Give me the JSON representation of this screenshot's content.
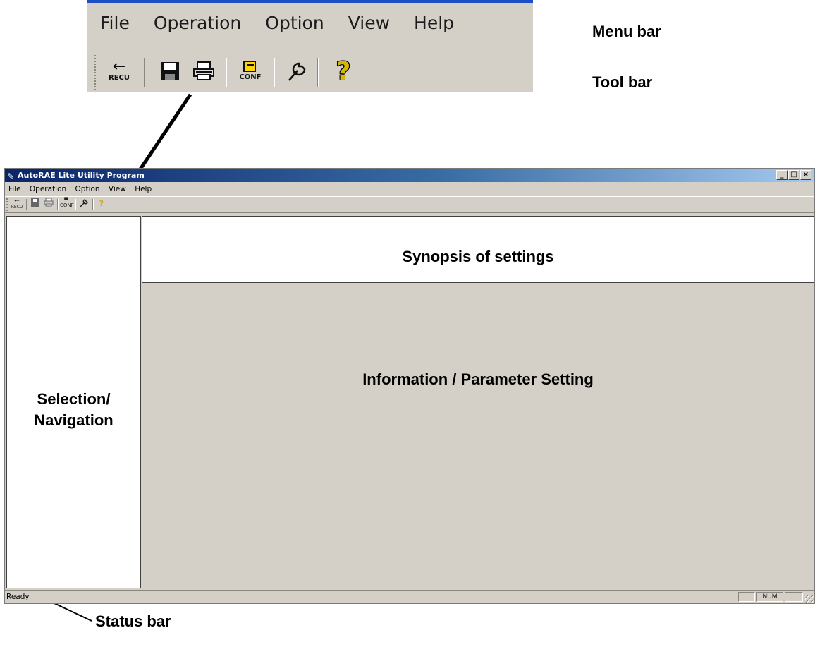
{
  "zoom": {
    "menu_items": [
      "File",
      "Operation",
      "Option",
      "View",
      "Help"
    ],
    "toolbar_icons": [
      "recv-icon",
      "save-icon",
      "print-icon",
      "conf-icon",
      "wrench-icon",
      "help-icon"
    ],
    "recv_label": "RECU",
    "conf_label": "CONF"
  },
  "callouts": {
    "menu_bar": "Menu bar",
    "tool_bar": "Tool bar",
    "status_bar": "Status bar"
  },
  "window": {
    "title": "AutoRAE Lite Utility Program",
    "menu_items": [
      "File",
      "Operation",
      "Option",
      "View",
      "Help"
    ],
    "panels": {
      "navigation_line1": "Selection/",
      "navigation_line2": "Navigation",
      "synopsis": "Synopsis of settings",
      "parameters": "Information / Parameter Setting"
    },
    "status": {
      "text": "Ready",
      "indicator": "NUM"
    }
  },
  "colors": {
    "title_gradient_start": "#0a246a",
    "face": "#d4d0c8",
    "zoom_top_border": "#1c4ec4"
  }
}
